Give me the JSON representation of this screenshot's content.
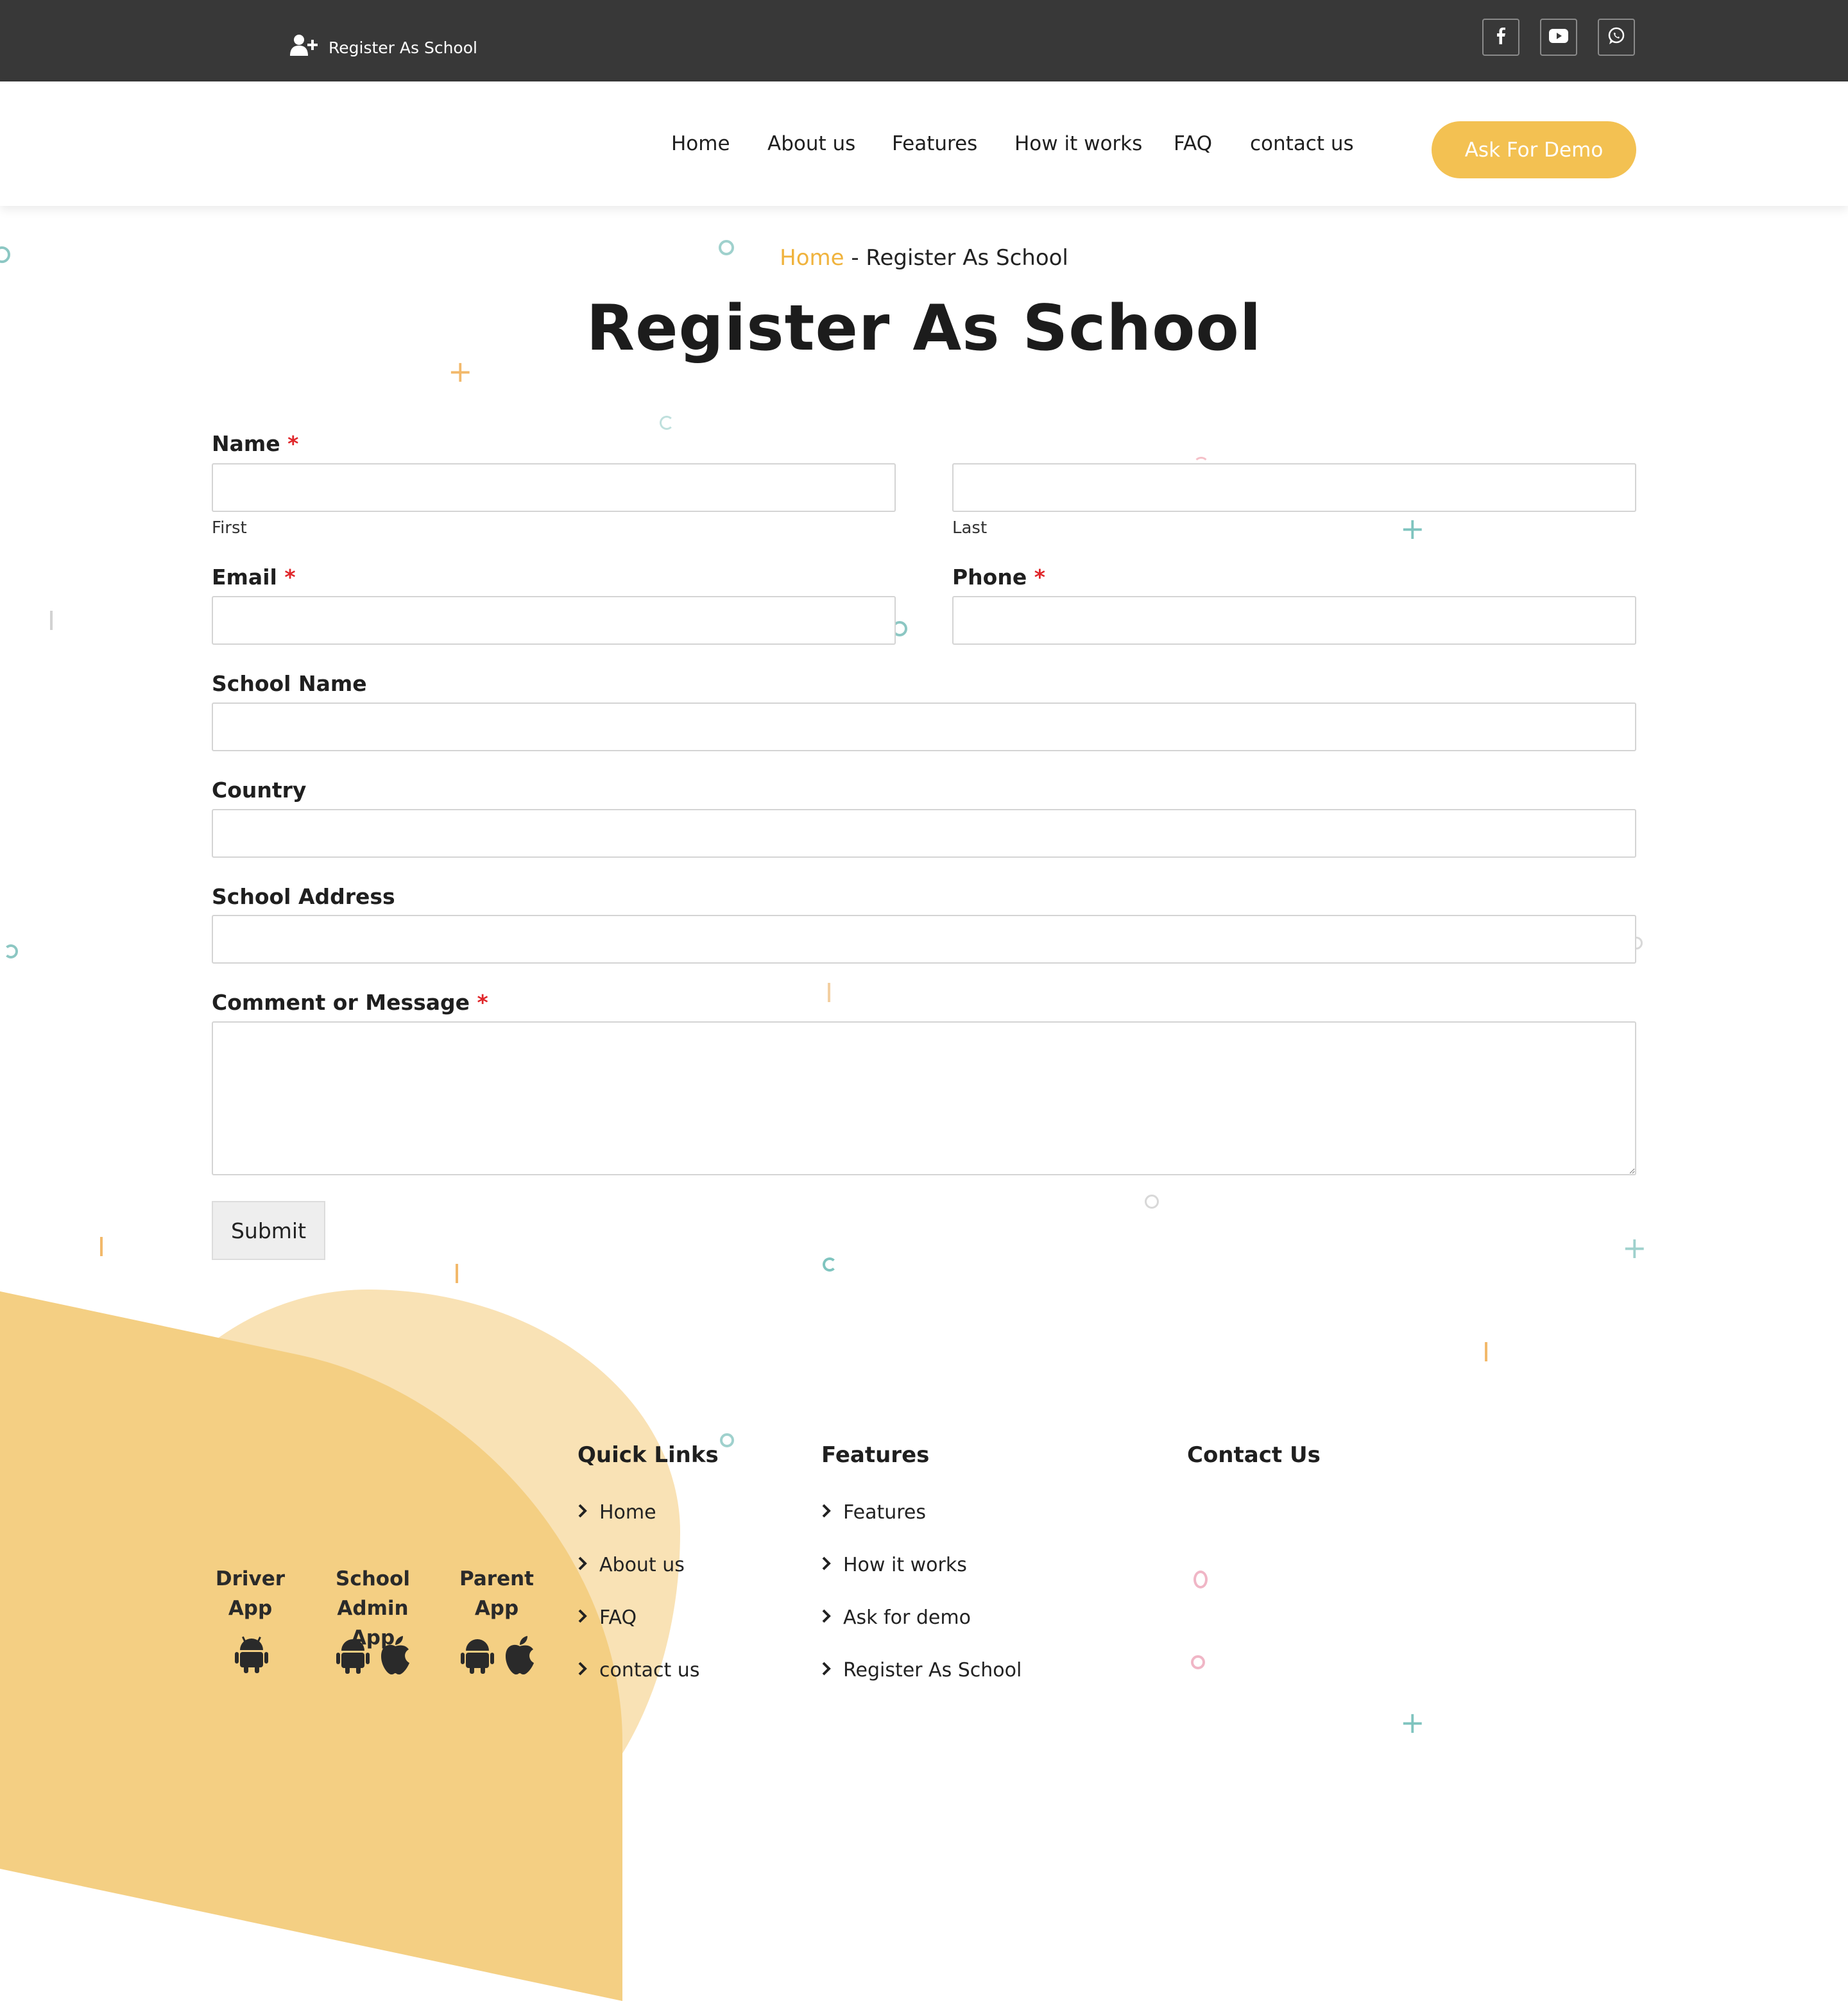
{
  "topbar": {
    "register_label": "Register As School",
    "social": [
      "facebook-icon",
      "youtube-icon",
      "whatsapp-icon"
    ]
  },
  "nav": {
    "items": [
      "Home",
      "About us",
      "Features",
      "How it works",
      "FAQ",
      "contact us"
    ],
    "demo_button": "Ask For Demo"
  },
  "breadcrumb": {
    "home": "Home",
    "separator": " - ",
    "current": "Register As School"
  },
  "page_title": "Register As School",
  "form": {
    "name_label": "Name",
    "first_sublabel": "First",
    "last_sublabel": "Last",
    "email_label": "Email",
    "phone_label": "Phone",
    "school_name_label": "School Name",
    "country_label": "Country",
    "school_address_label": "School Address",
    "message_label": "Comment or Message",
    "required_mark": "*",
    "submit_label": "Submit"
  },
  "footer": {
    "apps": [
      {
        "line1": "Driver",
        "line2": "App",
        "icons": [
          "android-icon"
        ]
      },
      {
        "line1": "School Admin",
        "line2": "App",
        "icons": [
          "android-icon",
          "apple-icon"
        ]
      },
      {
        "line1": "Parent",
        "line2": "App",
        "icons": [
          "android-icon",
          "apple-icon"
        ]
      }
    ],
    "quick_links": {
      "heading": "Quick Links",
      "items": [
        "Home",
        "About us",
        "FAQ",
        "contact us"
      ]
    },
    "features": {
      "heading": "Features",
      "items": [
        "Features",
        "How it works",
        "Ask for demo",
        "Register As School"
      ]
    },
    "contact": {
      "heading": "Contact Us"
    }
  },
  "colors": {
    "accent": "#f3c152",
    "topbar": "#383838",
    "required": "#e0262a",
    "breadcrumb_home": "#f0b33d"
  }
}
